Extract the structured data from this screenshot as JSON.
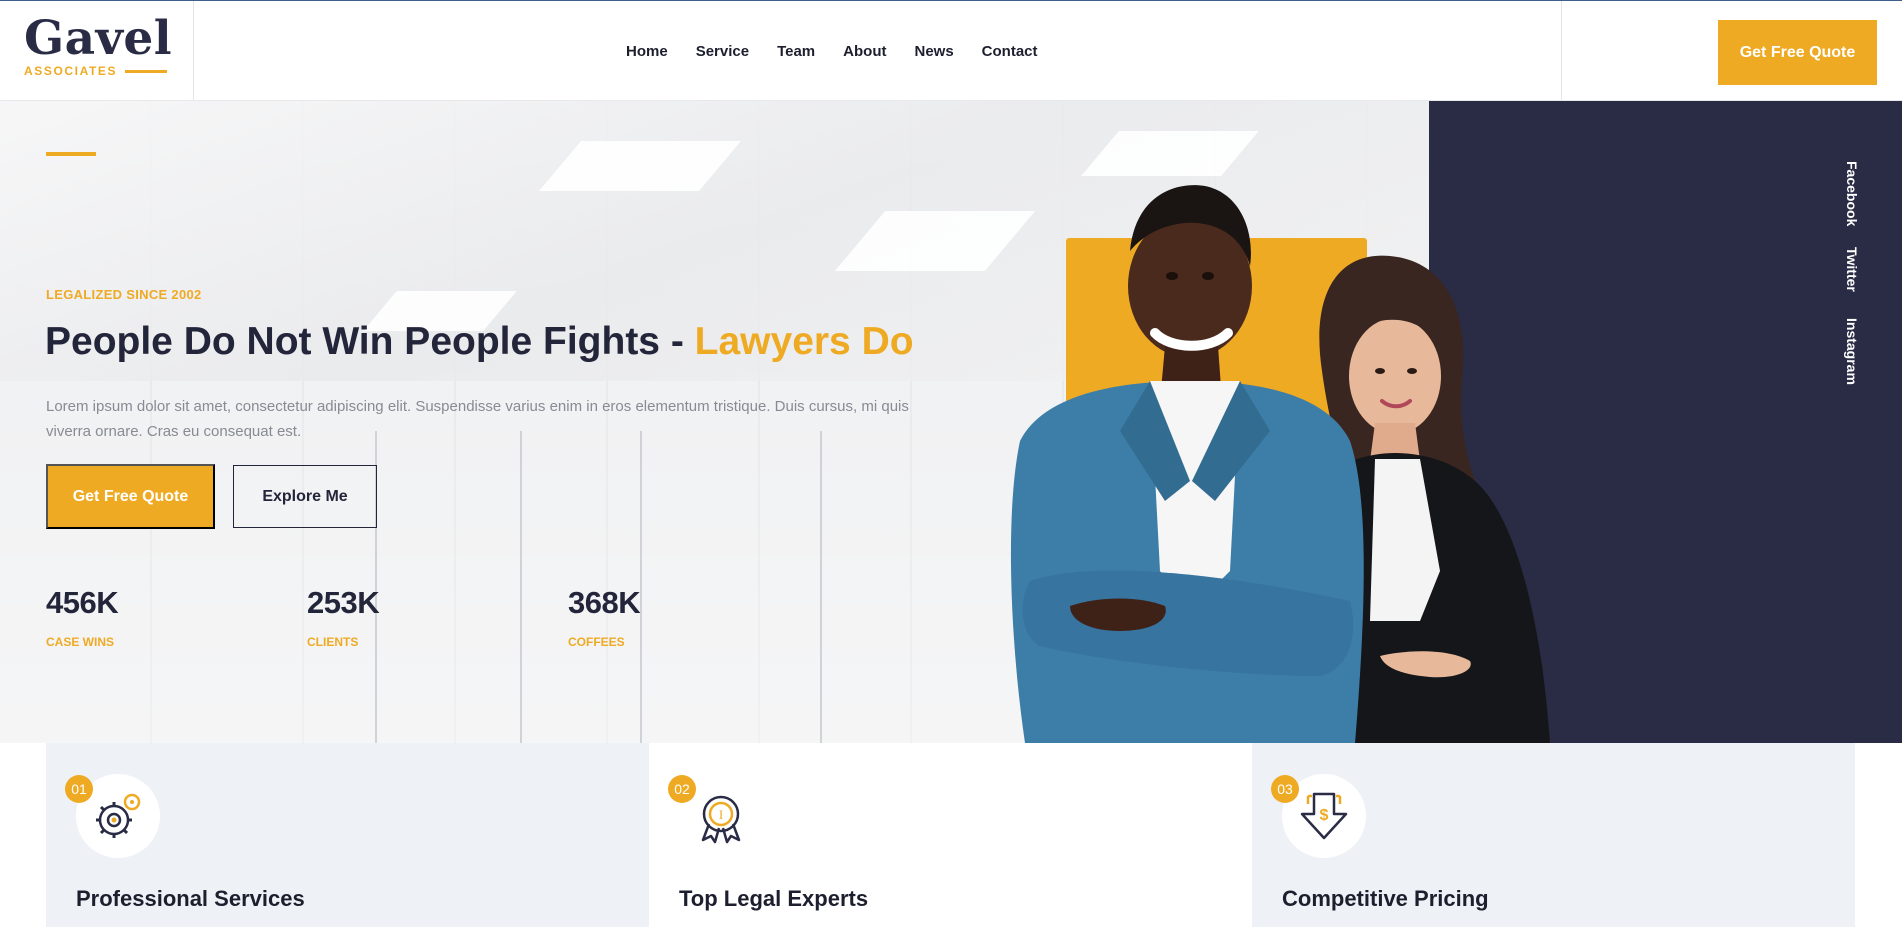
{
  "brand": {
    "name": "Gavel",
    "tagline": "ASSOCIATES"
  },
  "nav": {
    "items": [
      "Home",
      "Service",
      "Team",
      "About",
      "News",
      "Contact"
    ],
    "cta_label": "Get Free Quote"
  },
  "hero": {
    "kicker": "LEGALIZED SINCE 2002",
    "headline_main": "People Do Not Win People Fights - ",
    "headline_highlight": "Lawyers Do",
    "lead": "Lorem ipsum dolor sit amet, consectetur adipiscing elit. Suspendisse varius enim in eros elementum tristique. Duis cursus, mi quis viverra ornare. Cras eu consequat est.",
    "primary_button": "Get Free Quote",
    "secondary_button": "Explore Me",
    "stats": [
      {
        "value": "456K",
        "label": "CASE WINS"
      },
      {
        "value": "253K",
        "label": "CLIENTS"
      },
      {
        "value": "368K",
        "label": "COFFEES"
      }
    ]
  },
  "social": [
    "Facebook",
    "Twitter",
    "Instagram"
  ],
  "features": [
    {
      "num": "01",
      "title": "Professional Services",
      "icon": "gear-cog-icon"
    },
    {
      "num": "02",
      "title": "Top Legal Experts",
      "icon": "award-medal-icon"
    },
    {
      "num": "03",
      "title": "Competitive Pricing",
      "icon": "price-down-arrow-icon"
    }
  ],
  "colors": {
    "accent": "#efaa24",
    "navy": "#2a2c45",
    "text": "#23253a"
  }
}
